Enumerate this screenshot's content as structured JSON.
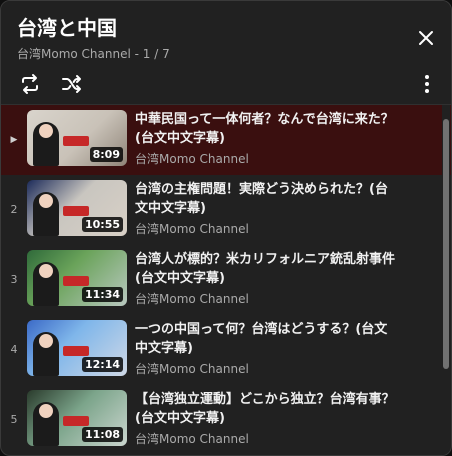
{
  "header": {
    "title": "台湾と中国",
    "subtitle": "台湾Momo Channel - 1 / 7"
  },
  "controls": {
    "loop_icon": "loop-icon",
    "shuffle_icon": "shuffle-icon",
    "more_icon": "more-vert-icon",
    "close_icon": "close-icon"
  },
  "playlist": [
    {
      "index": "▶",
      "title": "中華民国って一体何者？なんで台湾に来た？(台文中文字幕)",
      "channel": "台湾Momo Channel",
      "duration": "8:09",
      "active": true
    },
    {
      "index": "2",
      "title": "台湾の主権問題！実際どう決められた？(台文中文字幕)",
      "channel": "台湾Momo Channel",
      "duration": "10:55",
      "active": false
    },
    {
      "index": "3",
      "title": "台湾人が標的？米カリフォルニア銃乱射事件(台文中文字幕)",
      "channel": "台湾Momo Channel",
      "duration": "11:34",
      "active": false
    },
    {
      "index": "4",
      "title": "一つの中国って何？台湾はどうする？(台文中文字幕)",
      "channel": "台湾Momo Channel",
      "duration": "12:14",
      "active": false
    },
    {
      "index": "5",
      "title": "【台湾独立運動】どこから独立？台湾有事？(台文中文字幕)",
      "channel": "台湾Momo Channel",
      "duration": "11:08",
      "active": false
    }
  ]
}
